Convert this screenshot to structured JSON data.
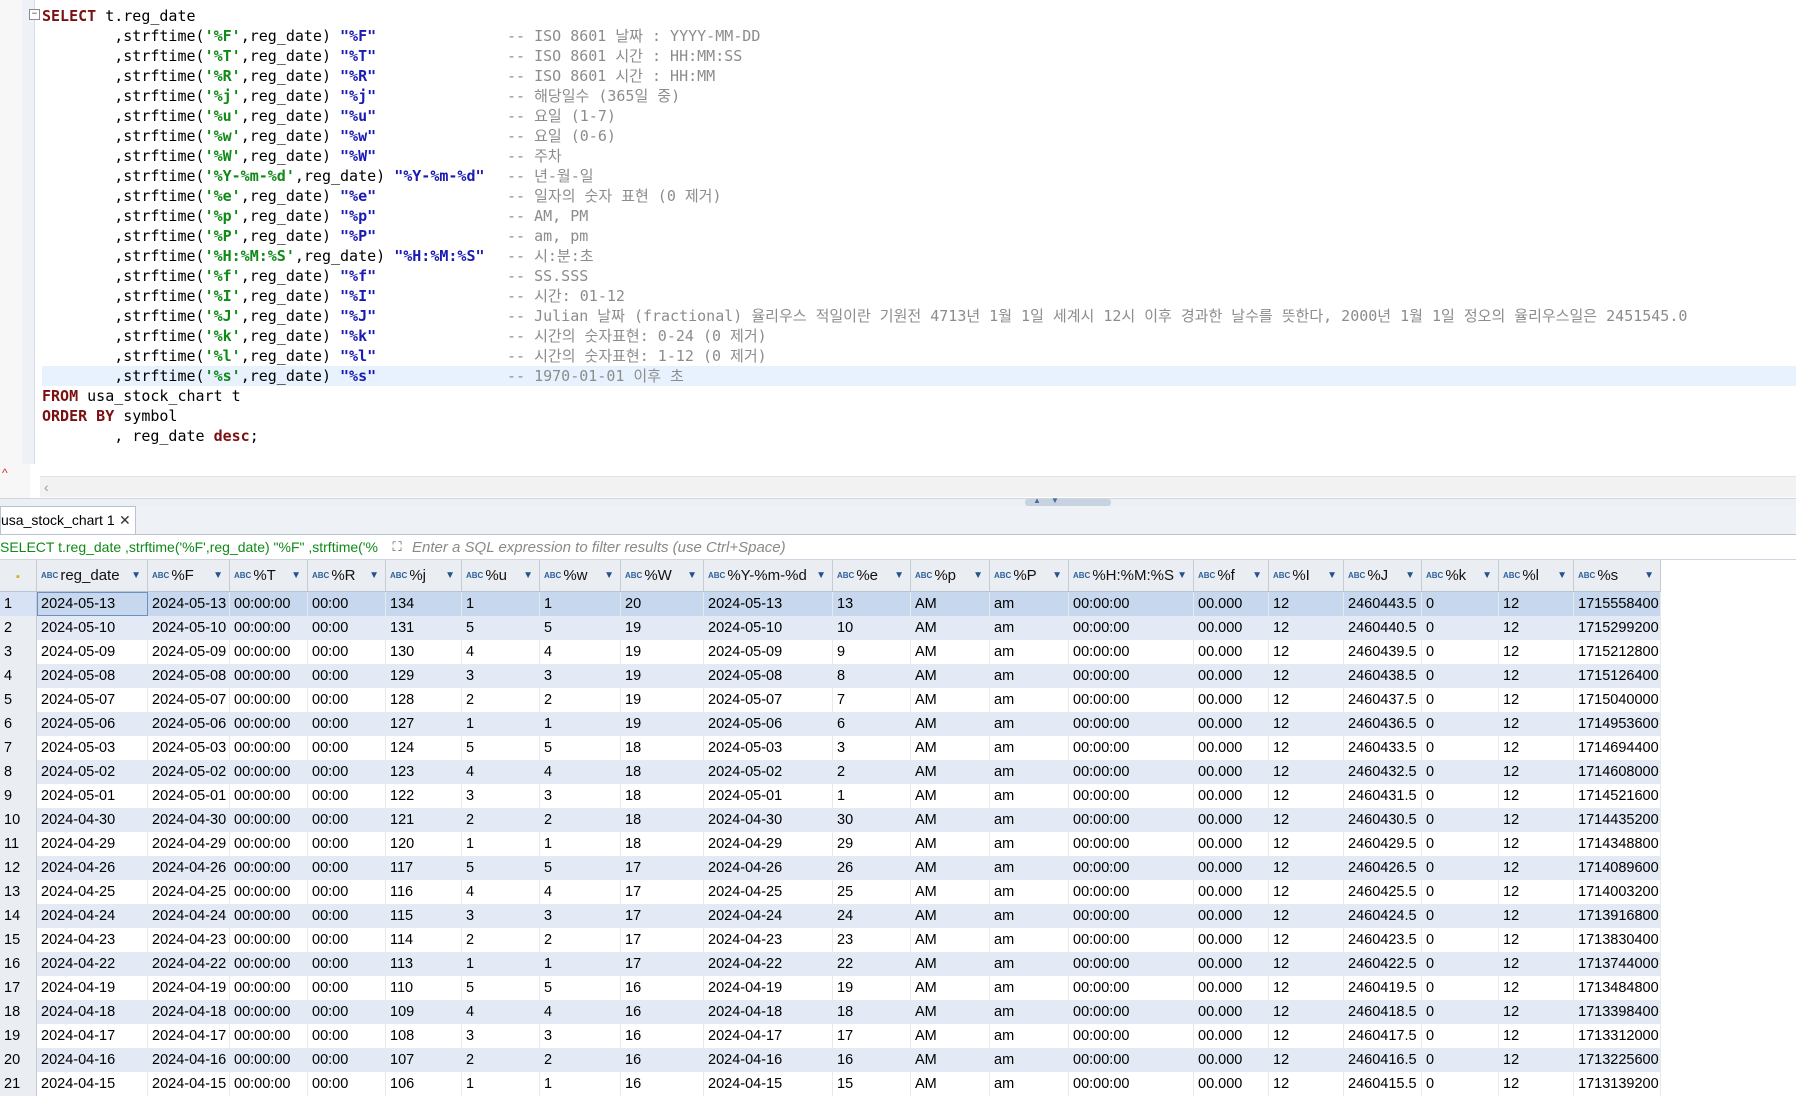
{
  "editor": {
    "lines": [
      {
        "parts": [
          [
            "kw",
            "SELECT"
          ],
          [
            "txt",
            " t.reg_date"
          ]
        ],
        "comment": ""
      },
      {
        "parts": [
          [
            "txt",
            "        ,strftime("
          ],
          [
            "str",
            "'%F'"
          ],
          [
            "txt",
            ",reg_date) "
          ],
          [
            "ali",
            "\"%F\""
          ]
        ],
        "comment": "-- ISO 8601 날짜 : YYYY-MM-DD"
      },
      {
        "parts": [
          [
            "txt",
            "        ,strftime("
          ],
          [
            "str",
            "'%T'"
          ],
          [
            "txt",
            ",reg_date) "
          ],
          [
            "ali",
            "\"%T\""
          ]
        ],
        "comment": "-- ISO 8601 시간 : HH:MM:SS"
      },
      {
        "parts": [
          [
            "txt",
            "        ,strftime("
          ],
          [
            "str",
            "'%R'"
          ],
          [
            "txt",
            ",reg_date) "
          ],
          [
            "ali",
            "\"%R\""
          ]
        ],
        "comment": "-- ISO 8601 시간 : HH:MM"
      },
      {
        "parts": [
          [
            "txt",
            "        ,strftime("
          ],
          [
            "str",
            "'%j'"
          ],
          [
            "txt",
            ",reg_date) "
          ],
          [
            "ali",
            "\"%j\""
          ]
        ],
        "comment": "-- 해당일수 (365일 중)"
      },
      {
        "parts": [
          [
            "txt",
            "        ,strftime("
          ],
          [
            "str",
            "'%u'"
          ],
          [
            "txt",
            ",reg_date) "
          ],
          [
            "ali",
            "\"%u\""
          ]
        ],
        "comment": "-- 요일 (1-7)"
      },
      {
        "parts": [
          [
            "txt",
            "        ,strftime("
          ],
          [
            "str",
            "'%w'"
          ],
          [
            "txt",
            ",reg_date) "
          ],
          [
            "ali",
            "\"%w\""
          ]
        ],
        "comment": "-- 요일 (0-6)"
      },
      {
        "parts": [
          [
            "txt",
            "        ,strftime("
          ],
          [
            "str",
            "'%W'"
          ],
          [
            "txt",
            ",reg_date) "
          ],
          [
            "ali",
            "\"%W\""
          ]
        ],
        "comment": "-- 주차"
      },
      {
        "parts": [
          [
            "txt",
            "        ,strftime("
          ],
          [
            "str",
            "'%Y-%m-%d'"
          ],
          [
            "txt",
            ",reg_date) "
          ],
          [
            "ali",
            "\"%Y-%m-%d\""
          ]
        ],
        "comment": "-- 년-월-일"
      },
      {
        "parts": [
          [
            "txt",
            "        ,strftime("
          ],
          [
            "str",
            "'%e'"
          ],
          [
            "txt",
            ",reg_date) "
          ],
          [
            "ali",
            "\"%e\""
          ]
        ],
        "comment": "-- 일자의 숫자 표현 (0 제거)"
      },
      {
        "parts": [
          [
            "txt",
            "        ,strftime("
          ],
          [
            "str",
            "'%p'"
          ],
          [
            "txt",
            ",reg_date) "
          ],
          [
            "ali",
            "\"%p\""
          ]
        ],
        "comment": "-- AM, PM"
      },
      {
        "parts": [
          [
            "txt",
            "        ,strftime("
          ],
          [
            "str",
            "'%P'"
          ],
          [
            "txt",
            ",reg_date) "
          ],
          [
            "ali",
            "\"%P\""
          ]
        ],
        "comment": "-- am, pm"
      },
      {
        "parts": [
          [
            "txt",
            "        ,strftime("
          ],
          [
            "str",
            "'%H:%M:%S'"
          ],
          [
            "txt",
            ",reg_date) "
          ],
          [
            "ali",
            "\"%H:%M:%S\""
          ]
        ],
        "comment": "-- 시:분:초"
      },
      {
        "parts": [
          [
            "txt",
            "        ,strftime("
          ],
          [
            "str",
            "'%f'"
          ],
          [
            "txt",
            ",reg_date) "
          ],
          [
            "ali",
            "\"%f\""
          ]
        ],
        "comment": "-- SS.SSS"
      },
      {
        "parts": [
          [
            "txt",
            "        ,strftime("
          ],
          [
            "str",
            "'%I'"
          ],
          [
            "txt",
            ",reg_date) "
          ],
          [
            "ali",
            "\"%I\""
          ]
        ],
        "comment": "-- 시간: 01-12"
      },
      {
        "parts": [
          [
            "txt",
            "        ,strftime("
          ],
          [
            "str",
            "'%J'"
          ],
          [
            "txt",
            ",reg_date) "
          ],
          [
            "ali",
            "\"%J\""
          ]
        ],
        "comment": "-- Julian 날짜 (fractional) 율리우스 적일이란 기원전 4713년 1월 1일 세계시 12시 이후 경과한 날수를 뜻한다, 2000년 1월 1일 정오의 율리우스일은 2451545.0"
      },
      {
        "parts": [
          [
            "txt",
            "        ,strftime("
          ],
          [
            "str",
            "'%k'"
          ],
          [
            "txt",
            ",reg_date) "
          ],
          [
            "ali",
            "\"%k\""
          ]
        ],
        "comment": "-- 시간의 숫자표현: 0-24 (0 제거)"
      },
      {
        "parts": [
          [
            "txt",
            "        ,strftime("
          ],
          [
            "str",
            "'%l'"
          ],
          [
            "txt",
            ",reg_date) "
          ],
          [
            "ali",
            "\"%l\""
          ]
        ],
        "comment": "-- 시간의 숫자표현: 1-12 (0 제거)"
      },
      {
        "parts": [
          [
            "txt",
            "        ,strftime("
          ],
          [
            "str",
            "'%s'"
          ],
          [
            "txt",
            ",reg_date) "
          ],
          [
            "ali",
            "\"%s\""
          ]
        ],
        "comment": "-- 1970-01-01 이후 초",
        "highlight": true
      },
      {
        "parts": [
          [
            "kw",
            "FROM"
          ],
          [
            "txt",
            " usa_stock_chart t"
          ]
        ],
        "comment": ""
      },
      {
        "parts": [
          [
            "kw",
            "ORDER BY"
          ],
          [
            "txt",
            " symbol"
          ]
        ],
        "comment": ""
      },
      {
        "parts": [
          [
            "txt",
            "        , reg_date "
          ],
          [
            "kw",
            "desc"
          ],
          [
            "txt",
            ";"
          ]
        ],
        "comment": ""
      }
    ]
  },
  "results": {
    "tab_label": "usa_stock_chart 1",
    "tab_close": "✕",
    "filter_sql": "SELECT t.reg_date ,strftime('%F',reg_date) \"%F\" ,strftime('%",
    "filter_placeholder": "Enter a SQL expression to filter results (use Ctrl+Space)",
    "columns": [
      {
        "name": "reg_date",
        "width": 106
      },
      {
        "name": "%F",
        "width": 77
      },
      {
        "name": "%T",
        "width": 73
      },
      {
        "name": "%R",
        "width": 73
      },
      {
        "name": "%j",
        "width": 71
      },
      {
        "name": "%u",
        "width": 73
      },
      {
        "name": "%w",
        "width": 76
      },
      {
        "name": "%W",
        "width": 78
      },
      {
        "name": "%Y-%m-%d",
        "width": 124
      },
      {
        "name": "%e",
        "width": 73
      },
      {
        "name": "%p",
        "width": 74
      },
      {
        "name": "%P",
        "width": 74
      },
      {
        "name": "%H:%M:%S",
        "width": 120
      },
      {
        "name": "%f",
        "width": 70
      },
      {
        "name": "%I",
        "width": 70
      },
      {
        "name": "%J",
        "width": 73
      },
      {
        "name": "%k",
        "width": 72
      },
      {
        "name": "%l",
        "width": 70
      },
      {
        "name": "%s",
        "width": 82
      }
    ],
    "rows": [
      [
        "2024-05-13",
        "2024-05-13",
        "00:00:00",
        "00:00",
        "134",
        "1",
        "1",
        "20",
        "2024-05-13",
        "13",
        "AM",
        "am",
        "00:00:00",
        "00.000",
        "12",
        "2460443.5",
        "0",
        "12",
        "1715558400"
      ],
      [
        "2024-05-10",
        "2024-05-10",
        "00:00:00",
        "00:00",
        "131",
        "5",
        "5",
        "19",
        "2024-05-10",
        "10",
        "AM",
        "am",
        "00:00:00",
        "00.000",
        "12",
        "2460440.5",
        "0",
        "12",
        "1715299200"
      ],
      [
        "2024-05-09",
        "2024-05-09",
        "00:00:00",
        "00:00",
        "130",
        "4",
        "4",
        "19",
        "2024-05-09",
        "9",
        "AM",
        "am",
        "00:00:00",
        "00.000",
        "12",
        "2460439.5",
        "0",
        "12",
        "1715212800"
      ],
      [
        "2024-05-08",
        "2024-05-08",
        "00:00:00",
        "00:00",
        "129",
        "3",
        "3",
        "19",
        "2024-05-08",
        "8",
        "AM",
        "am",
        "00:00:00",
        "00.000",
        "12",
        "2460438.5",
        "0",
        "12",
        "1715126400"
      ],
      [
        "2024-05-07",
        "2024-05-07",
        "00:00:00",
        "00:00",
        "128",
        "2",
        "2",
        "19",
        "2024-05-07",
        "7",
        "AM",
        "am",
        "00:00:00",
        "00.000",
        "12",
        "2460437.5",
        "0",
        "12",
        "1715040000"
      ],
      [
        "2024-05-06",
        "2024-05-06",
        "00:00:00",
        "00:00",
        "127",
        "1",
        "1",
        "19",
        "2024-05-06",
        "6",
        "AM",
        "am",
        "00:00:00",
        "00.000",
        "12",
        "2460436.5",
        "0",
        "12",
        "1714953600"
      ],
      [
        "2024-05-03",
        "2024-05-03",
        "00:00:00",
        "00:00",
        "124",
        "5",
        "5",
        "18",
        "2024-05-03",
        "3",
        "AM",
        "am",
        "00:00:00",
        "00.000",
        "12",
        "2460433.5",
        "0",
        "12",
        "1714694400"
      ],
      [
        "2024-05-02",
        "2024-05-02",
        "00:00:00",
        "00:00",
        "123",
        "4",
        "4",
        "18",
        "2024-05-02",
        "2",
        "AM",
        "am",
        "00:00:00",
        "00.000",
        "12",
        "2460432.5",
        "0",
        "12",
        "1714608000"
      ],
      [
        "2024-05-01",
        "2024-05-01",
        "00:00:00",
        "00:00",
        "122",
        "3",
        "3",
        "18",
        "2024-05-01",
        "1",
        "AM",
        "am",
        "00:00:00",
        "00.000",
        "12",
        "2460431.5",
        "0",
        "12",
        "1714521600"
      ],
      [
        "2024-04-30",
        "2024-04-30",
        "00:00:00",
        "00:00",
        "121",
        "2",
        "2",
        "18",
        "2024-04-30",
        "30",
        "AM",
        "am",
        "00:00:00",
        "00.000",
        "12",
        "2460430.5",
        "0",
        "12",
        "1714435200"
      ],
      [
        "2024-04-29",
        "2024-04-29",
        "00:00:00",
        "00:00",
        "120",
        "1",
        "1",
        "18",
        "2024-04-29",
        "29",
        "AM",
        "am",
        "00:00:00",
        "00.000",
        "12",
        "2460429.5",
        "0",
        "12",
        "1714348800"
      ],
      [
        "2024-04-26",
        "2024-04-26",
        "00:00:00",
        "00:00",
        "117",
        "5",
        "5",
        "17",
        "2024-04-26",
        "26",
        "AM",
        "am",
        "00:00:00",
        "00.000",
        "12",
        "2460426.5",
        "0",
        "12",
        "1714089600"
      ],
      [
        "2024-04-25",
        "2024-04-25",
        "00:00:00",
        "00:00",
        "116",
        "4",
        "4",
        "17",
        "2024-04-25",
        "25",
        "AM",
        "am",
        "00:00:00",
        "00.000",
        "12",
        "2460425.5",
        "0",
        "12",
        "1714003200"
      ],
      [
        "2024-04-24",
        "2024-04-24",
        "00:00:00",
        "00:00",
        "115",
        "3",
        "3",
        "17",
        "2024-04-24",
        "24",
        "AM",
        "am",
        "00:00:00",
        "00.000",
        "12",
        "2460424.5",
        "0",
        "12",
        "1713916800"
      ],
      [
        "2024-04-23",
        "2024-04-23",
        "00:00:00",
        "00:00",
        "114",
        "2",
        "2",
        "17",
        "2024-04-23",
        "23",
        "AM",
        "am",
        "00:00:00",
        "00.000",
        "12",
        "2460423.5",
        "0",
        "12",
        "1713830400"
      ],
      [
        "2024-04-22",
        "2024-04-22",
        "00:00:00",
        "00:00",
        "113",
        "1",
        "1",
        "17",
        "2024-04-22",
        "22",
        "AM",
        "am",
        "00:00:00",
        "00.000",
        "12",
        "2460422.5",
        "0",
        "12",
        "1713744000"
      ],
      [
        "2024-04-19",
        "2024-04-19",
        "00:00:00",
        "00:00",
        "110",
        "5",
        "5",
        "16",
        "2024-04-19",
        "19",
        "AM",
        "am",
        "00:00:00",
        "00.000",
        "12",
        "2460419.5",
        "0",
        "12",
        "1713484800"
      ],
      [
        "2024-04-18",
        "2024-04-18",
        "00:00:00",
        "00:00",
        "109",
        "4",
        "4",
        "16",
        "2024-04-18",
        "18",
        "AM",
        "am",
        "00:00:00",
        "00.000",
        "12",
        "2460418.5",
        "0",
        "12",
        "1713398400"
      ],
      [
        "2024-04-17",
        "2024-04-17",
        "00:00:00",
        "00:00",
        "108",
        "3",
        "3",
        "16",
        "2024-04-17",
        "17",
        "AM",
        "am",
        "00:00:00",
        "00.000",
        "12",
        "2460417.5",
        "0",
        "12",
        "1713312000"
      ],
      [
        "2024-04-16",
        "2024-04-16",
        "00:00:00",
        "00:00",
        "107",
        "2",
        "2",
        "16",
        "2024-04-16",
        "16",
        "AM",
        "am",
        "00:00:00",
        "00.000",
        "12",
        "2460416.5",
        "0",
        "12",
        "1713225600"
      ],
      [
        "2024-04-15",
        "2024-04-15",
        "00:00:00",
        "00:00",
        "106",
        "1",
        "1",
        "16",
        "2024-04-15",
        "15",
        "AM",
        "am",
        "00:00:00",
        "00.000",
        "12",
        "2460415.5",
        "0",
        "12",
        "1713139200"
      ]
    ],
    "selected_row": 0,
    "type_badge": "ABC",
    "sort_arrow": "▼"
  },
  "icons": {
    "fold": "⊖",
    "scroll_left": "‹",
    "expand": "⛶",
    "key": "🔒"
  },
  "colors": {
    "keyword": "#7b1010",
    "string": "#0f8a17",
    "alias": "#1a1ab4",
    "comment": "#8c8c8c",
    "row_alt": "#e3eaf5",
    "row_selected": "#c7d8ee"
  }
}
